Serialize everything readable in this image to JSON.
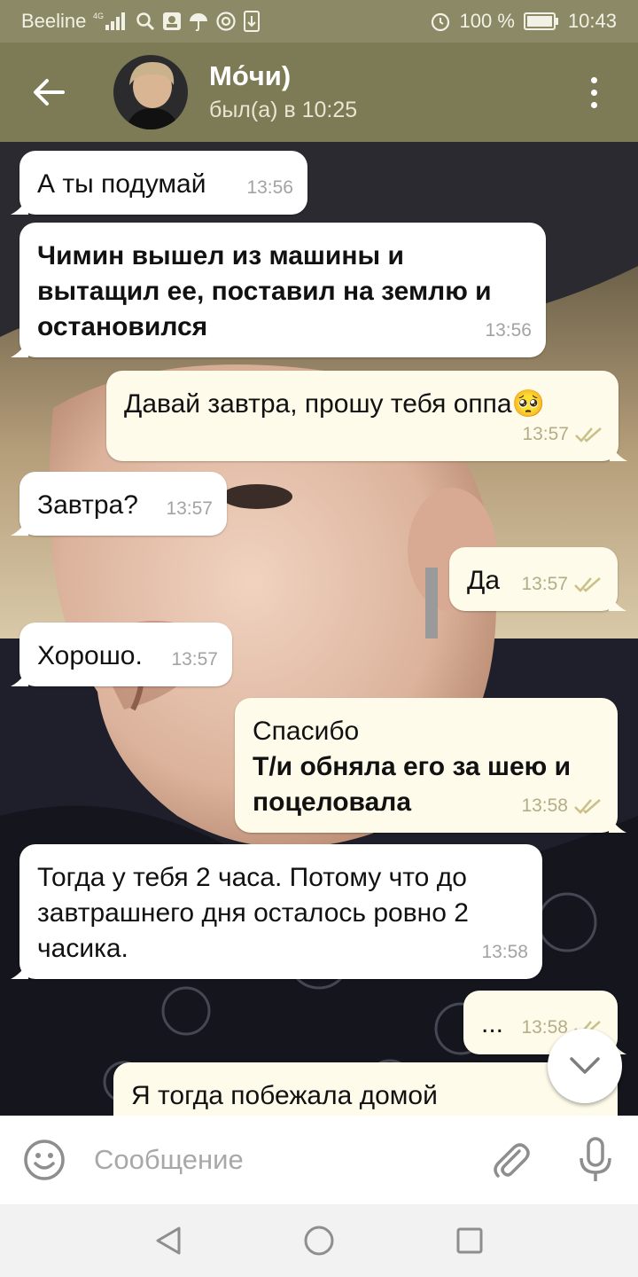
{
  "status_bar": {
    "carrier": "Beeline",
    "network": "4G",
    "battery": "100 %",
    "time": "10:43",
    "icons": [
      "signal-icon",
      "search-icon",
      "image-icon",
      "umbrella-icon",
      "at-icon",
      "download-icon",
      "alarm-icon",
      "battery-icon"
    ]
  },
  "header": {
    "name": "Мо́чи)",
    "status": "был(а) в 10:25",
    "back_icon": "arrow-left-icon",
    "menu_icon": "more-vertical-icon"
  },
  "colors": {
    "header_bg": "#7d7b55",
    "status_bg": "#8c8a66",
    "incoming_bubble": "#ffffff",
    "outgoing_bubble": "#fefbea",
    "check_color": "#c9c08a"
  },
  "messages": [
    {
      "direction": "in",
      "text": "А ты подумай",
      "bold": "",
      "time": "13:56"
    },
    {
      "direction": "in",
      "text": "",
      "bold": "Чимин вышел из машины и вытащил ее, поставил на землю и остановился",
      "time": "13:56"
    },
    {
      "direction": "out",
      "text": "Давай завтра, прошу тебя оппа🥺",
      "bold": "",
      "time": "13:57",
      "read": true
    },
    {
      "direction": "in",
      "text": "Завтра?",
      "bold": "",
      "time": "13:57"
    },
    {
      "direction": "out",
      "text": "Да",
      "bold": "",
      "time": "13:57",
      "read": true
    },
    {
      "direction": "in",
      "text": "Хорошо.",
      "bold": "",
      "time": "13:57"
    },
    {
      "direction": "out",
      "text": "Спасибо",
      "bold": "Т/и обняла его за шею и поцеловала",
      "time": "13:58",
      "read": true
    },
    {
      "direction": "in",
      "text": "Тогда у тебя 2 часа. Потому что до завтрашнего дня осталось ровно 2 часика.",
      "bold": "",
      "time": "13:58"
    },
    {
      "direction": "out",
      "text": "...",
      "bold": "",
      "time": "13:58",
      "read": true
    },
    {
      "direction": "out",
      "text": "Я тогда побежала домой",
      "bold": "",
      "time": ""
    }
  ],
  "input": {
    "placeholder": "Сообщение",
    "value": ""
  },
  "nav": {
    "icons": [
      "back-triangle-icon",
      "home-circle-icon",
      "recents-square-icon"
    ]
  }
}
